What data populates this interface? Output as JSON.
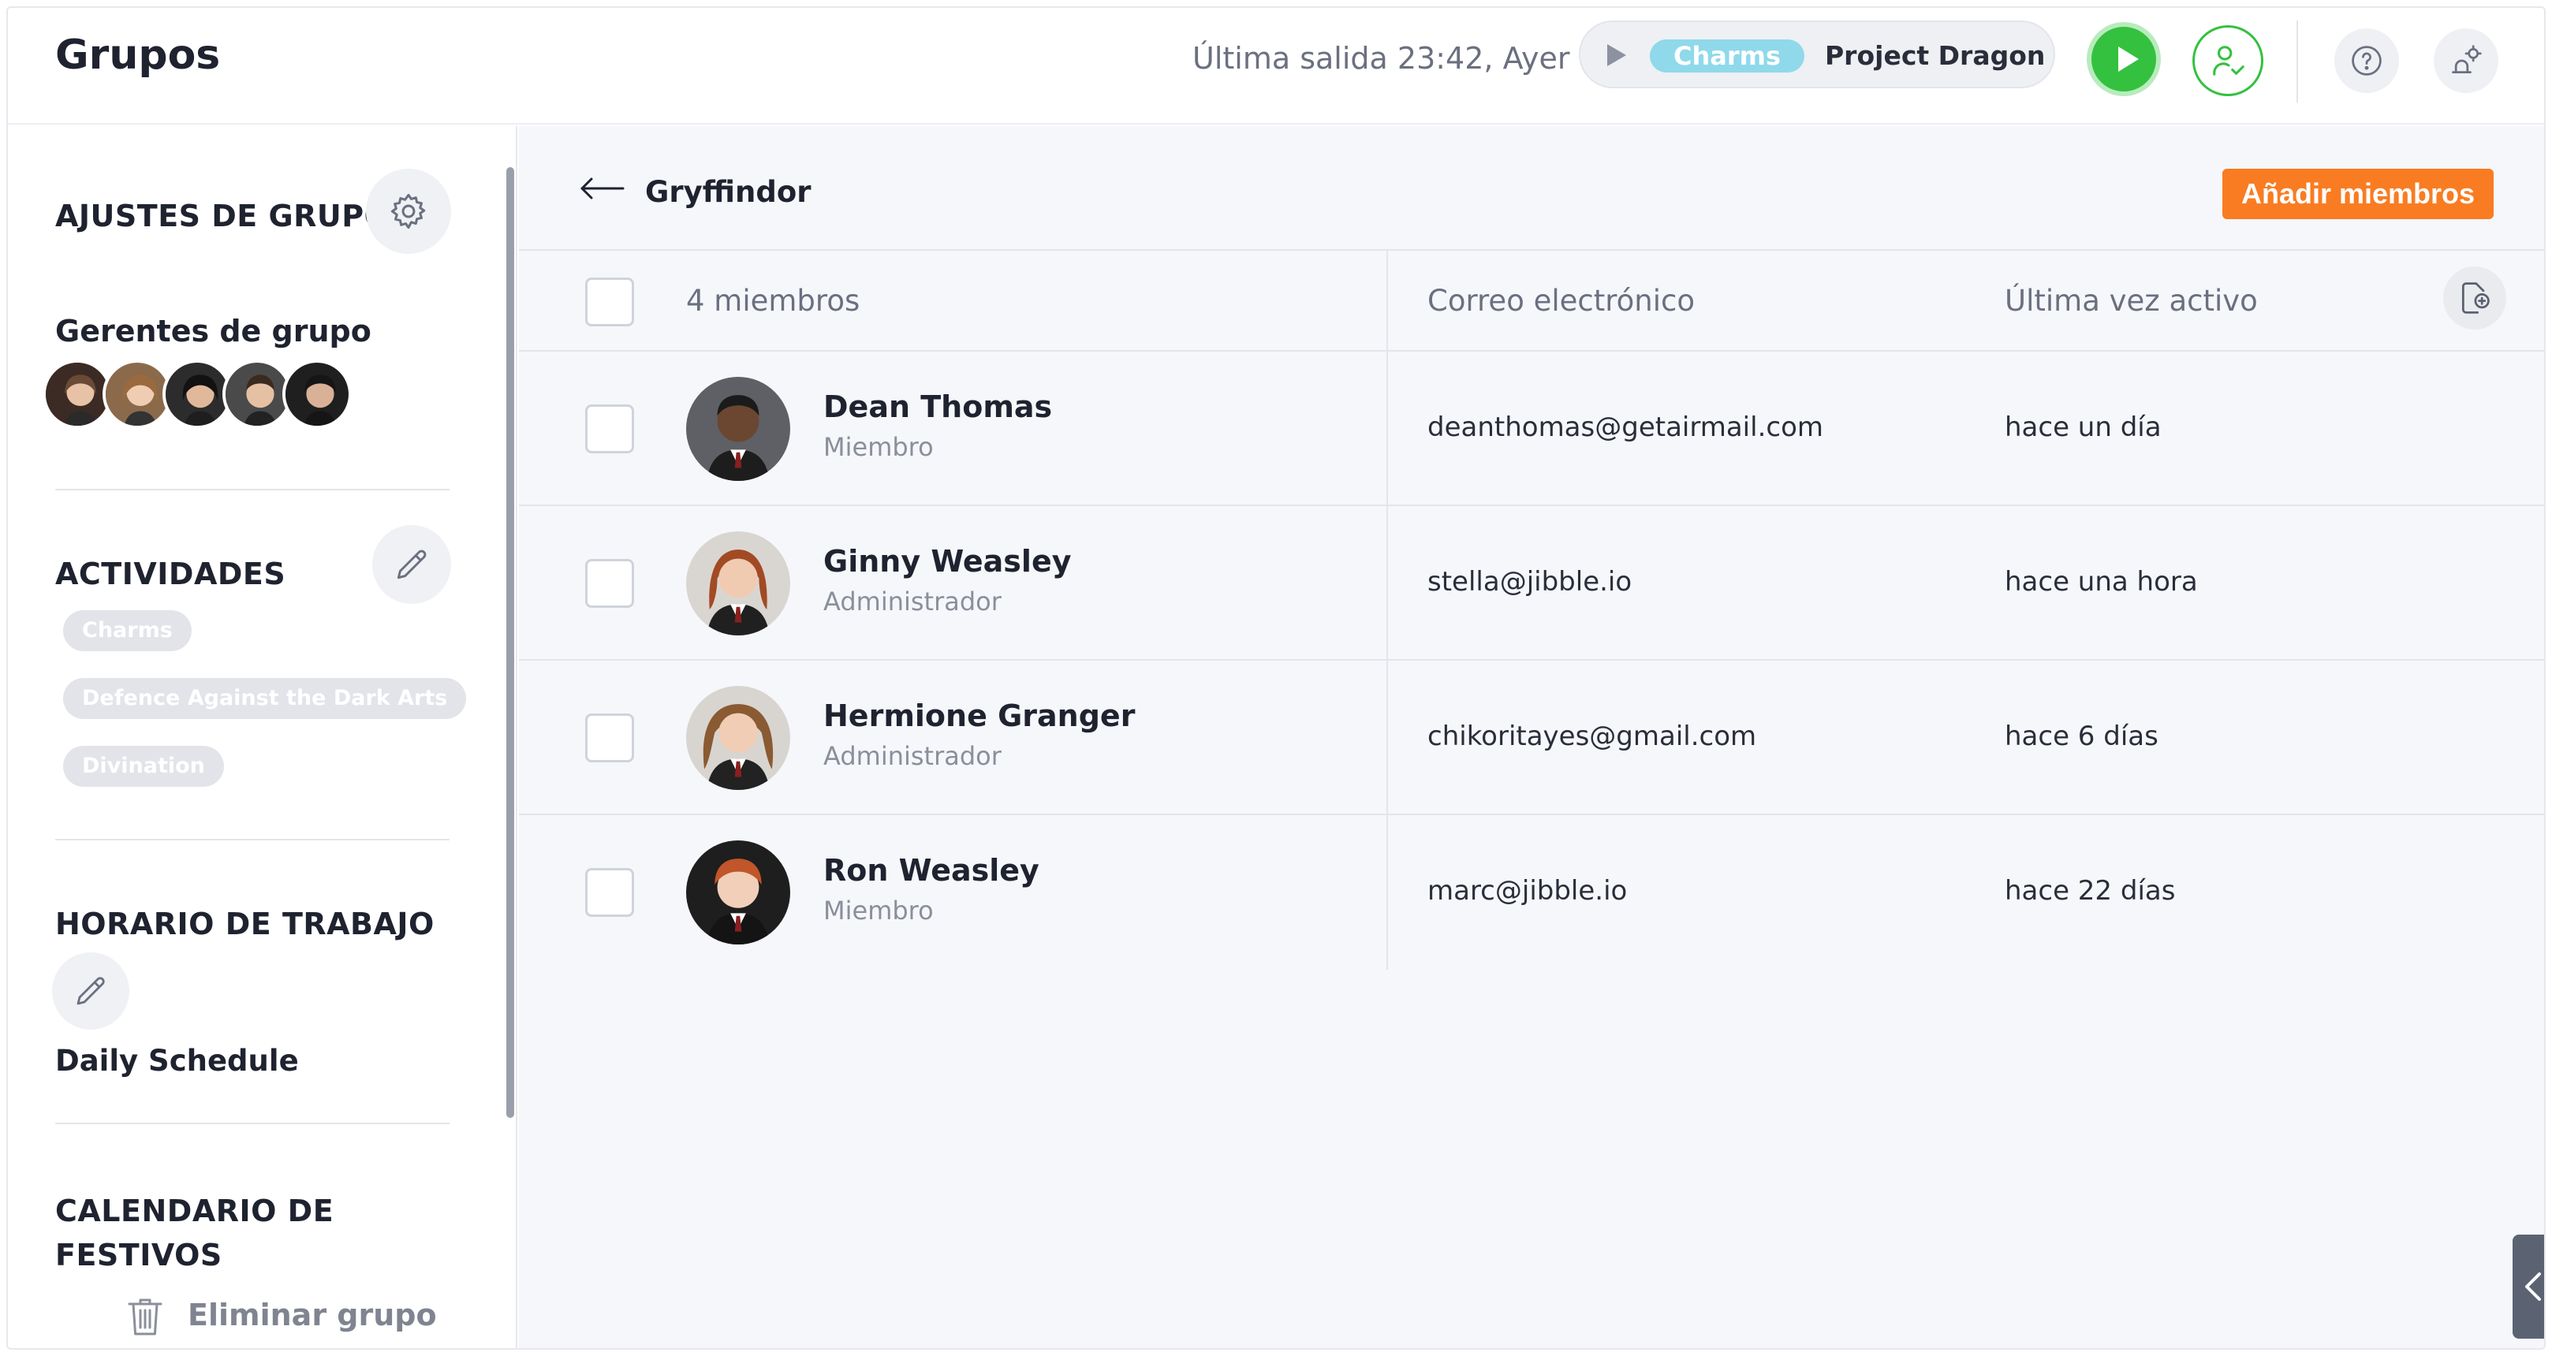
{
  "header": {
    "title": "Grupos",
    "last_out": "Última salida 23:42, Ayer",
    "timer": {
      "activity": "Charms",
      "project": "Project Dragon"
    }
  },
  "sidebar": {
    "group_settings_title": "AJUSTES DE GRUPO",
    "managers_label": "Gerentes de grupo",
    "activities_title": "ACTIVIDADES",
    "activities": [
      "Charms",
      "Defence Against the Dark Arts",
      "Divination"
    ],
    "schedule_title": "HORARIO DE TRABAJO",
    "schedule_name": "Daily Schedule",
    "holiday_title": "CALENDARIO DE FESTIVOS",
    "delete_label": "Eliminar grupo"
  },
  "main": {
    "group_name": "Gryffindor",
    "add_members_label": "Añadir miembros",
    "table": {
      "count_label": "4 miembros",
      "email_header": "Correo electrónico",
      "last_active_header": "Última vez activo",
      "rows": [
        {
          "name": "Dean Thomas",
          "role": "Miembro",
          "email": "deanthomas@getairmail.com",
          "last_active": "hace un día"
        },
        {
          "name": "Ginny Weasley",
          "role": "Administrador",
          "email": "stella@jibble.io",
          "last_active": "hace una hora"
        },
        {
          "name": "Hermione Granger",
          "role": "Administrador",
          "email": "chikoritayes@gmail.com",
          "last_active": "hace 6 días"
        },
        {
          "name": "Ron Weasley",
          "role": "Miembro",
          "email": "marc@jibble.io",
          "last_active": "hace 22 días"
        }
      ]
    }
  },
  "colors": {
    "accent_orange": "#f97c22",
    "play_green": "#34c13f",
    "activity_chip": "#8fd9ea"
  },
  "icons": [
    "play-icon",
    "user-check-icon",
    "help-icon",
    "settings-icon",
    "gear-icon",
    "pencil-icon",
    "trash-icon",
    "arrow-left-icon",
    "export-icon",
    "chevron-left-icon"
  ]
}
